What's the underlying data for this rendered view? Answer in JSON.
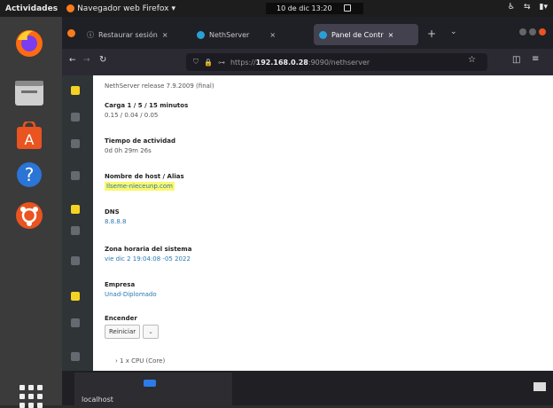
{
  "topbar": {
    "activities": "Actividades",
    "app_name": "Navegador web Firefox",
    "clock": "10 de dic 13:20"
  },
  "tabs": [
    {
      "label": "Restaurar sesión"
    },
    {
      "label": "NethServer"
    },
    {
      "label": "Panel de Contr"
    }
  ],
  "url": {
    "prefix": "https://",
    "host": "192.168.0.28",
    "rest": ":9090/nethserver"
  },
  "content": {
    "release": "NethServer release 7.9.2009 (final)",
    "fields": [
      {
        "label": "Carga 1 / 5 / 15 minutos",
        "value": "0.15 / 0.04 / 0.05",
        "plain": true
      },
      {
        "label": "Tiempo de actividad",
        "value": "0d 0h 29m 26s",
        "plain": true
      },
      {
        "label": "Nombre de host / Alias",
        "value": "Ilseme-nieceunp.com",
        "highlight": true
      },
      {
        "label": "DNS",
        "value": "8.8.8.8"
      },
      {
        "label": "Zona horaria del sistema",
        "value": "vie dic 2 19:04:08 -05 2022"
      },
      {
        "label": "Empresa",
        "value": "Unad-Diplomado"
      },
      {
        "label": "Encender"
      }
    ],
    "reboot_label": "Reiniciar",
    "cpu": "1 x CPU (Core)"
  },
  "taskbar": {
    "label": "localhost"
  }
}
